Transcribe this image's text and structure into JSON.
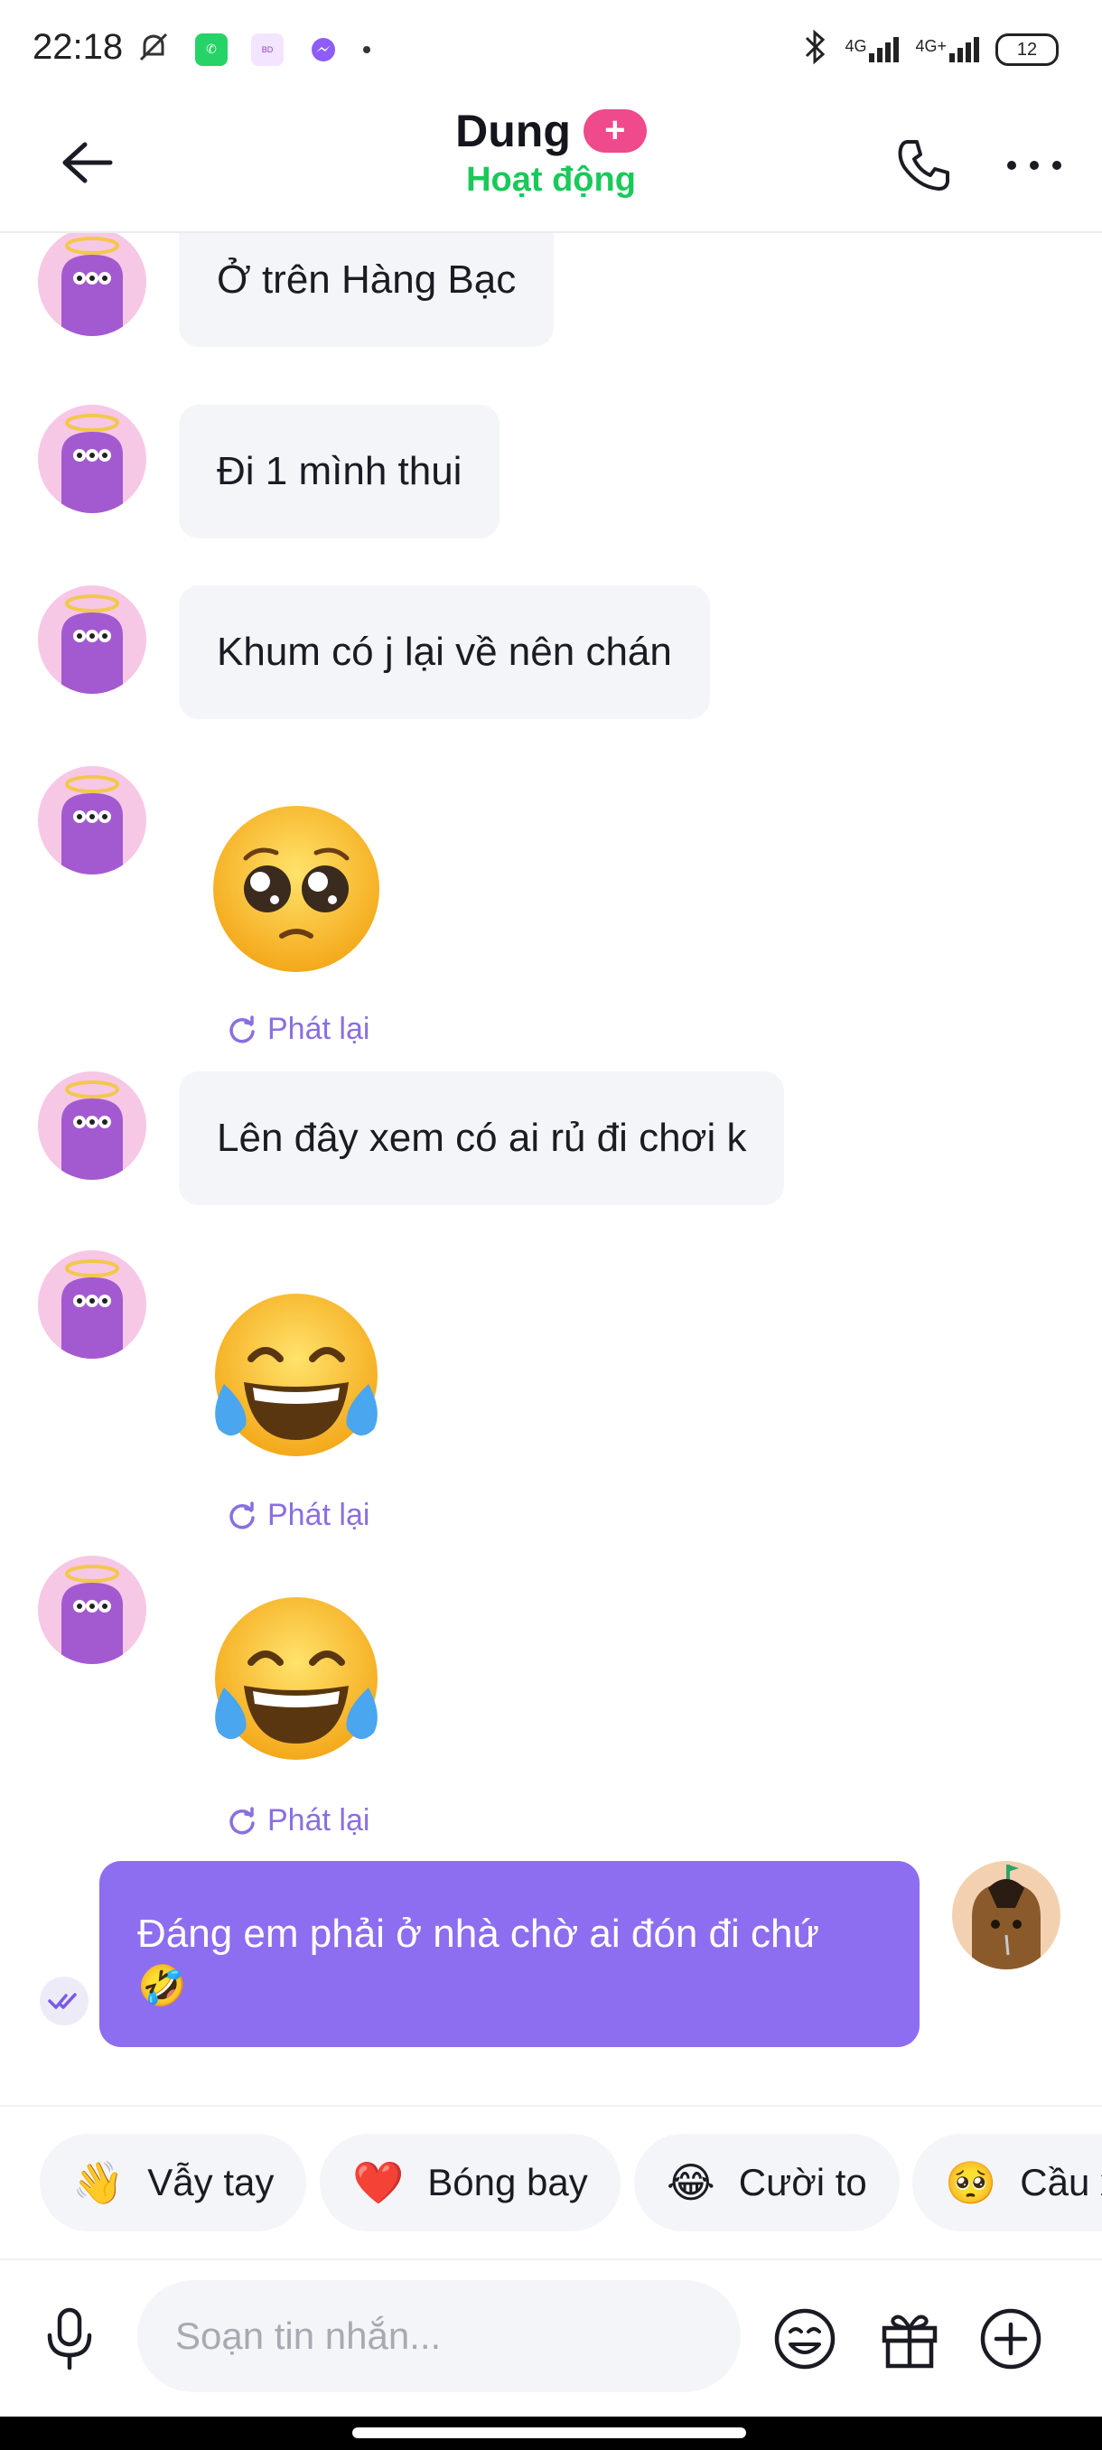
{
  "status_bar": {
    "time": "22:18",
    "battery": "12",
    "network_1": "4G",
    "network_2": "4G+",
    "app_icons": [
      "mute-icon",
      "whatsapp-icon",
      "badoo-icon",
      "messenger-icon"
    ]
  },
  "header": {
    "name": "Dung",
    "status": "Hoạt động",
    "plus_badge": "+"
  },
  "messages": [
    {
      "from": "them",
      "type": "text",
      "text": "Ở trên Hàng Bạc"
    },
    {
      "from": "them",
      "type": "text",
      "text": "Đi 1 mình thui"
    },
    {
      "from": "them",
      "type": "text",
      "text": "Khum có j lại về nên chán"
    },
    {
      "from": "them",
      "type": "emoji",
      "emoji": "🥺",
      "replay": "Phát lại"
    },
    {
      "from": "them",
      "type": "text",
      "text": "Lên đây xem có ai rủ đi chơi k"
    },
    {
      "from": "them",
      "type": "emoji",
      "emoji": "😂",
      "replay": "Phát lại"
    },
    {
      "from": "them",
      "type": "emoji",
      "emoji": "😂",
      "replay": "Phát lại"
    },
    {
      "from": "me",
      "type": "text",
      "text": "Đáng em phải ở nhà chờ ai đón đi chứ",
      "emoji": "🤣"
    }
  ],
  "quick_replies": [
    {
      "emoji": "👋",
      "label": "Vẫy tay"
    },
    {
      "emoji": "❤️",
      "label": "Bóng bay"
    },
    {
      "emoji": "😂",
      "label": "Cười to"
    },
    {
      "emoji": "🥺",
      "label": "Cầu x"
    }
  ],
  "composer": {
    "placeholder": "Soạn tin nhắn..."
  },
  "colors": {
    "accent": "#8d6df0",
    "online": "#19c95a",
    "badge": "#ee4a8c",
    "bubble_them": "#f4f5f8"
  }
}
